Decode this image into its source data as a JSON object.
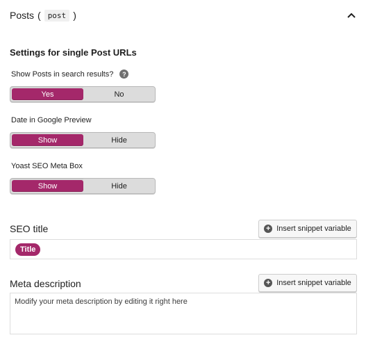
{
  "header": {
    "title": "Posts",
    "open_paren": "(",
    "code": "post",
    "close_paren": ")"
  },
  "section_heading": "Settings for single Post URLs",
  "search_results": {
    "label": "Show Posts in search results?",
    "help_glyph": "?",
    "options": [
      "Yes",
      "No"
    ],
    "selected": "Yes"
  },
  "date_preview": {
    "label": "Date in Google Preview",
    "options": [
      "Show",
      "Hide"
    ],
    "selected": "Show"
  },
  "meta_box": {
    "label": "Yoast SEO Meta Box",
    "options": [
      "Show",
      "Hide"
    ],
    "selected": "Show"
  },
  "seo_title": {
    "label": "SEO title",
    "button": "Insert snippet variable",
    "pill": "Title"
  },
  "meta_description": {
    "label": "Meta description",
    "button": "Insert snippet variable",
    "placeholder": "Modify your meta description by editing it right here"
  },
  "colors": {
    "accent": "#a4286a",
    "toggle_bg": "#dcdcdc"
  }
}
